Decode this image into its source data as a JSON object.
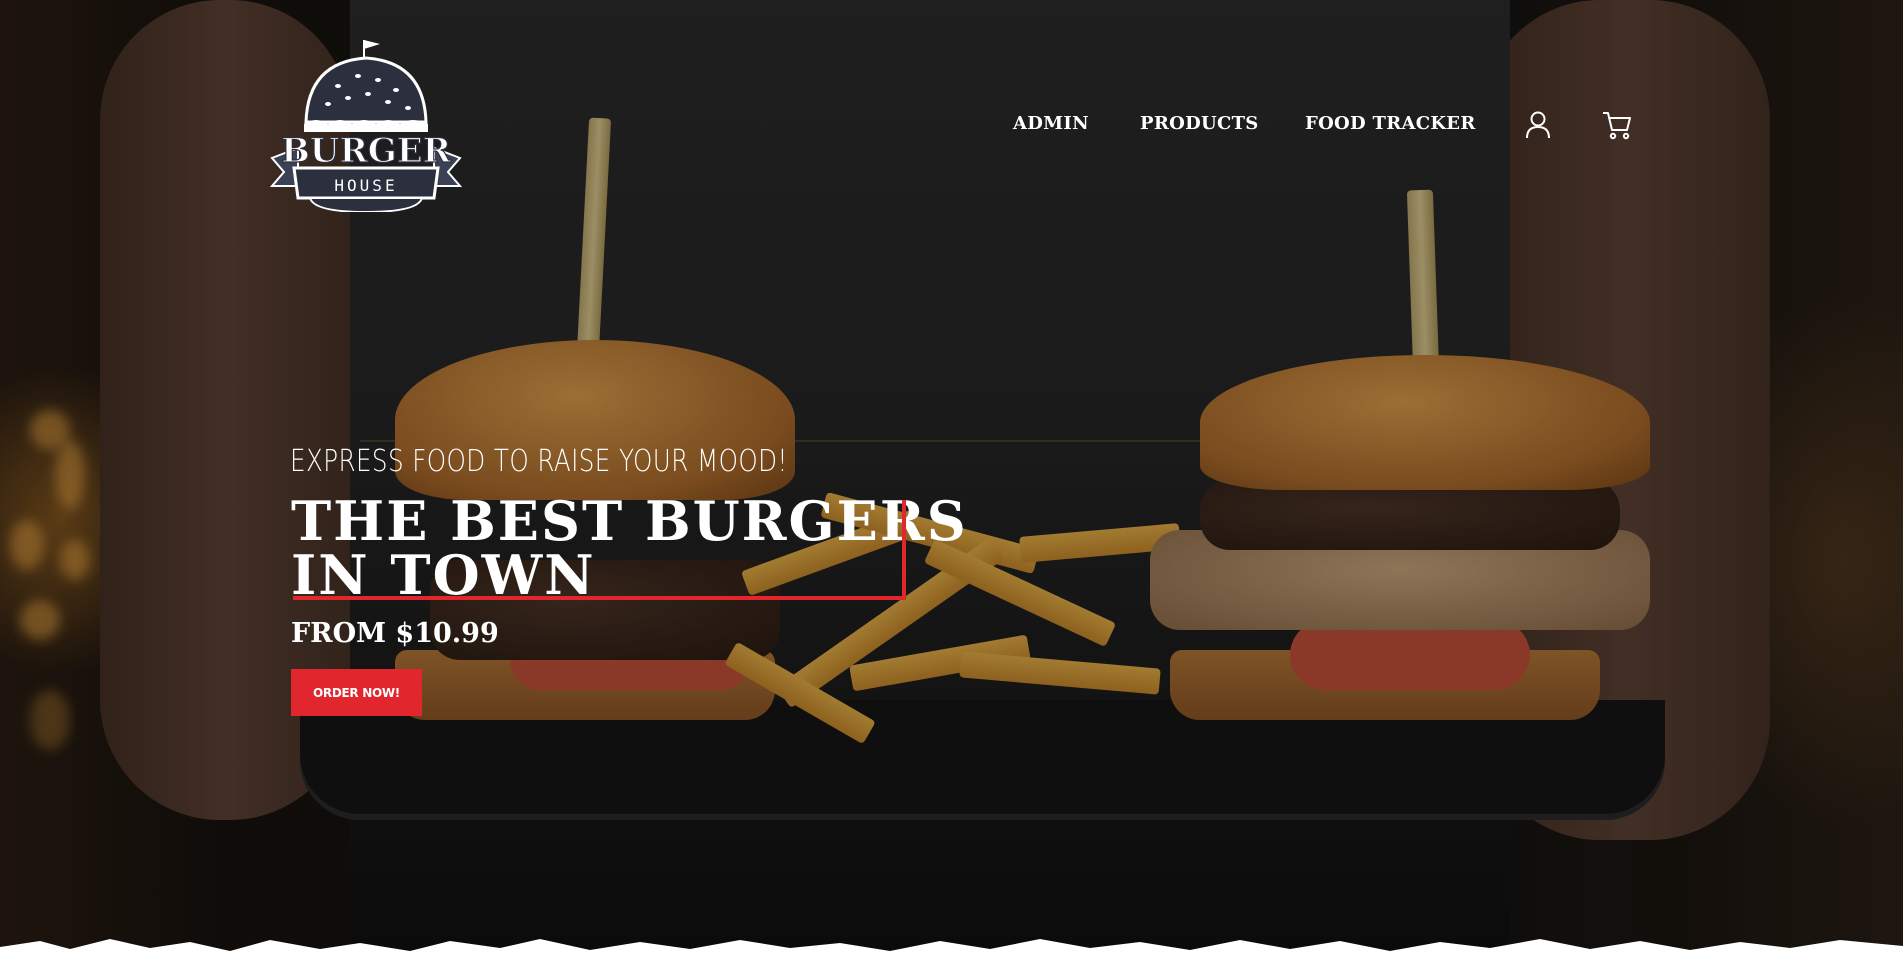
{
  "brand": {
    "logo_top": "BURGER",
    "logo_bottom": "HOUSE",
    "logo_icon": "burger-icon"
  },
  "nav": {
    "items": [
      {
        "label": "ADMIN"
      },
      {
        "label": "PRODUCTS"
      },
      {
        "label": "FOOD TRACKER"
      }
    ],
    "account_icon": "user-icon",
    "cart_icon": "cart-icon"
  },
  "hero": {
    "tagline": "EXPRESS FOOD TO RAISE YOUR MOOD!",
    "headline_line1": "THE BEST BURGERS",
    "headline_line2": "IN TOWN",
    "price": "FROM $10.99",
    "cta_label": "ORDER NOW!"
  },
  "colors": {
    "accent": "#e1262d",
    "text": "#ffffff",
    "logo_navy": "#2b2f3e"
  }
}
